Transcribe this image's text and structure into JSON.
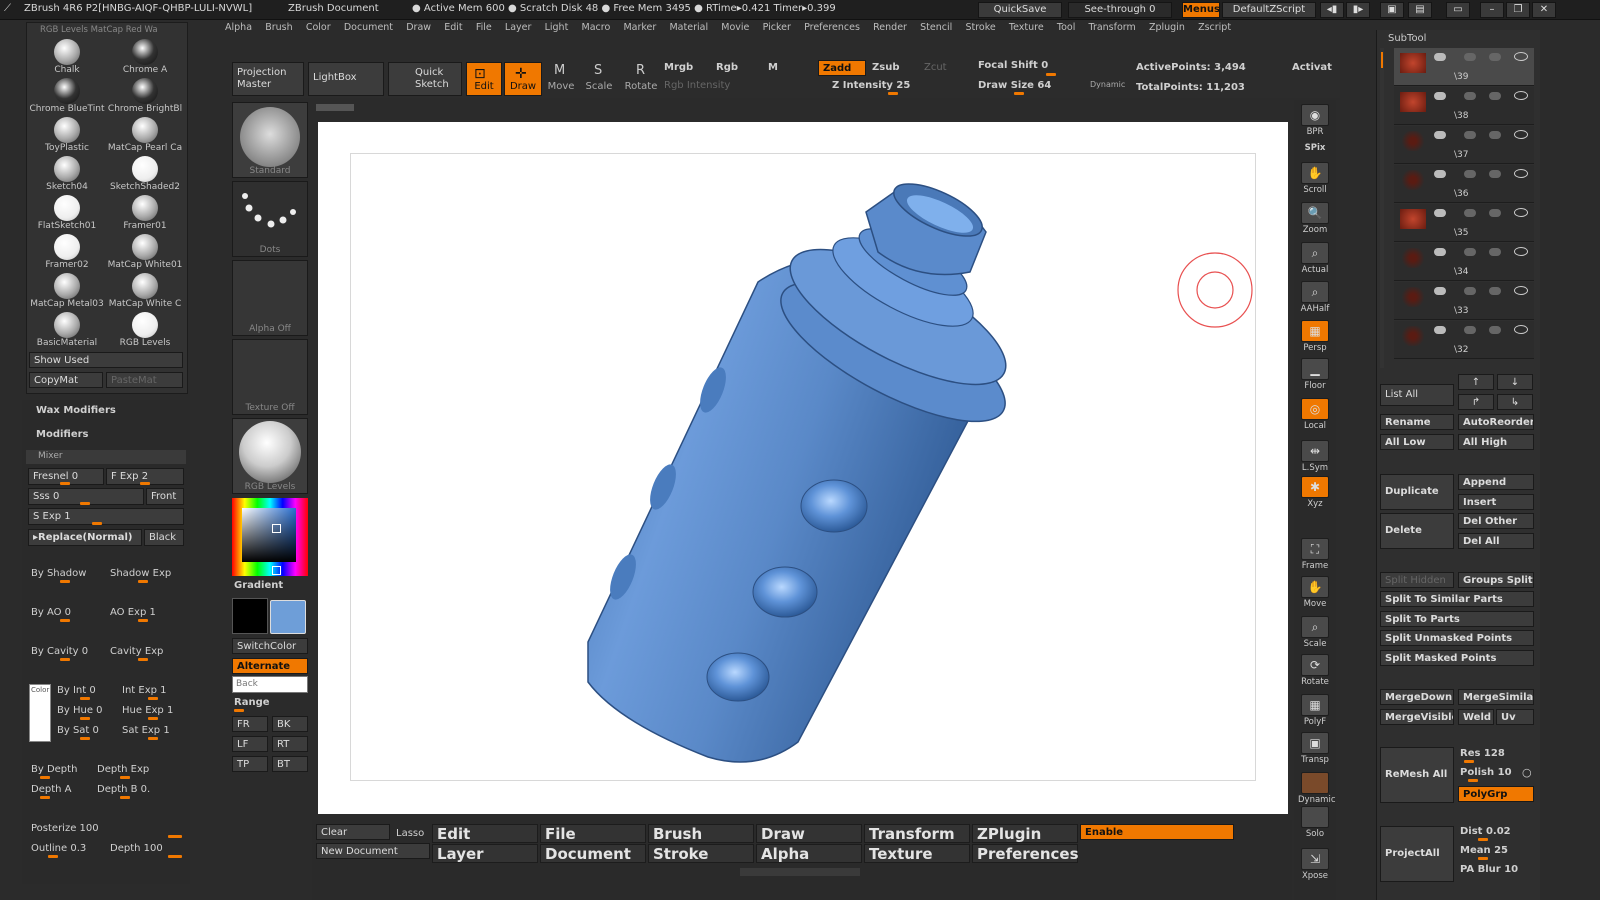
{
  "titlebar": {
    "app": "ZBrush 4R6 P2[HNBG-AIQF-QHBP-LULI-NVWL]",
    "doc": "ZBrush Document",
    "mem": "● Active Mem 600 ● Scratch Disk 48 ● Free Mem 3495 ● RTime▸0.421 Timer▸0.399",
    "quicksave": "QuickSave",
    "seethrough": "See-through 0",
    "menus": "Menus",
    "script": "DefaultZScript"
  },
  "menubar": [
    "Alpha",
    "Brush",
    "Color",
    "Document",
    "Draw",
    "Edit",
    "File",
    "Layer",
    "Light",
    "Macro",
    "Marker",
    "Material",
    "Movie",
    "Picker",
    "Preferences",
    "Render",
    "Stencil",
    "Stroke",
    "Texture",
    "Tool",
    "Transform",
    "Zplugin",
    "Zscript"
  ],
  "materials": {
    "header": "RGB Levels   MatCap Red Wa",
    "items": [
      {
        "label": "Chalk"
      },
      {
        "label": "Chrome A"
      },
      {
        "label": "Chrome BlueTint"
      },
      {
        "label": "Chrome BrightBl"
      },
      {
        "label": "ToyPlastic"
      },
      {
        "label": "MatCap Pearl Ca"
      },
      {
        "label": "Sketch04"
      },
      {
        "label": "SketchShaded2"
      },
      {
        "label": "FlatSketch01"
      },
      {
        "label": "Framer01"
      },
      {
        "label": "Framer02"
      },
      {
        "label": "MatCap White01"
      },
      {
        "label": "MatCap Metal03"
      },
      {
        "label": "MatCap White C"
      },
      {
        "label": "BasicMaterial"
      },
      {
        "label": "RGB Levels"
      }
    ],
    "show_used": "Show Used",
    "copymat": "CopyMat",
    "pastemat": "PasteMat"
  },
  "left_panel": {
    "wax": "Wax Modifiers",
    "modifiers": "Modifiers",
    "mixer": "Mixer",
    "fresnel": "Fresnel 0",
    "fexp": "F Exp 2",
    "sss": "Sss 0",
    "front": "Front",
    "sexp": "S Exp 1",
    "replace": "▸Replace(Normal)",
    "black": "Black",
    "byshadow": "By Shadow",
    "shadowexp": "Shadow Exp",
    "byao": "By AO 0",
    "aoexp": "AO Exp 1",
    "bycavity": "By Cavity 0",
    "cavityexp": "Cavity Exp",
    "color": "Color",
    "byint": "By Int 0",
    "intexp": "Int Exp 1",
    "byhue": "By Hue 0",
    "hueexp": "Hue Exp 1",
    "bysat": "By Sat 0",
    "satexp": "Sat Exp 1",
    "bydepth": "By Depth",
    "depthexp": "Depth Exp",
    "deptha": "Depth A",
    "depthb": "Depth B 0.",
    "posterize": "Posterize 100",
    "outline": "Outline 0.3",
    "depth": "Depth 100"
  },
  "tool_column": {
    "standard": "Standard",
    "dots": "Dots",
    "alpha": "Alpha Off",
    "texture": "Texture Off",
    "rgblevels": "RGB Levels",
    "gradient": "Gradient",
    "switchcolor": "SwitchColor",
    "alternate": "Alternate",
    "back": "Back",
    "range": "Range",
    "fr": "FR",
    "bk": "BK",
    "lf": "LF",
    "rt": "RT",
    "tp": "TP",
    "bt": "BT",
    "main_color": "#6e9ed8"
  },
  "toolbar": {
    "projection": "Projection Master",
    "lightbox": "LightBox",
    "quicksketch": "Quick Sketch",
    "edit": "Edit",
    "draw": "Draw",
    "move": "Move",
    "scale": "Scale",
    "rotate": "Rotate",
    "mrgb": "Mrgb",
    "rgb": "Rgb",
    "m": "M",
    "rgbintensity": "Rgb Intensity",
    "zadd": "Zadd",
    "zsub": "Zsub",
    "zcut": "Zcut",
    "zintensity": "Z Intensity 25",
    "focal": "Focal Shift 0",
    "drawsize": "Draw Size 64",
    "dynamic": "Dynamic",
    "activepoints": "ActivePoints: 3,494",
    "totalpoints": "TotalPoints: 11,203",
    "activate": "Activat"
  },
  "right_shelf": [
    {
      "label": "BPR",
      "glyph": "◉"
    },
    {
      "label": "SPix",
      "glyph": ""
    },
    {
      "label": "Scroll",
      "glyph": "✋"
    },
    {
      "label": "Zoom",
      "glyph": "🔍"
    },
    {
      "label": "Actual",
      "glyph": "⌕"
    },
    {
      "label": "AAHalf",
      "glyph": "⌕"
    },
    {
      "label": "Persp",
      "glyph": "▦"
    },
    {
      "label": "Floor",
      "glyph": "▁"
    },
    {
      "label": "Local",
      "glyph": "◎"
    },
    {
      "label": "L.Sym",
      "glyph": "⇹"
    },
    {
      "label": "Xyz",
      "glyph": "✱"
    },
    {
      "label": "Frame",
      "glyph": "⛶"
    },
    {
      "label": "Move",
      "glyph": "✋"
    },
    {
      "label": "Scale",
      "glyph": "⌕"
    },
    {
      "label": "Rotate",
      "glyph": "⟳"
    },
    {
      "label": "PolyF",
      "glyph": "▦"
    },
    {
      "label": "Transp",
      "glyph": "▣"
    },
    {
      "label": "Dynamic",
      "glyph": ""
    },
    {
      "label": "Solo",
      "glyph": ""
    },
    {
      "label": "Xpose",
      "glyph": "⇲"
    }
  ],
  "subtool": {
    "title": "SubTool",
    "items": [
      "\\39",
      "\\38",
      "\\37",
      "\\36",
      "\\35",
      "\\34",
      "\\33",
      "\\32"
    ],
    "listall": "List All",
    "rename": "Rename",
    "autoreorder": "AutoReorder",
    "alllow": "All Low",
    "allhigh": "All High",
    "duplicate": "Duplicate",
    "append": "Append",
    "insert": "Insert",
    "delete": "Delete",
    "delother": "Del Other",
    "delall": "Del All",
    "splithidden": "Split Hidden",
    "groupssplit": "Groups Split",
    "splitsimilar": "Split To Similar Parts",
    "splitparts": "Split To Parts",
    "splitunmasked": "Split Unmasked Points",
    "splitmasked": "Split Masked Points",
    "mergedown": "MergeDown",
    "mergesimilar": "MergeSimilar",
    "mergevisible": "MergeVisible",
    "weld": "Weld",
    "uv": "Uv",
    "remeshall": "ReMesh All",
    "res": "Res 128",
    "polish": "Polish 10",
    "polygrp": "PolyGrp",
    "projectall": "ProjectAll",
    "dist": "Dist 0.02",
    "mean": "Mean 25",
    "pablur": "PA Blur 10"
  },
  "bottom": {
    "clear": "Clear",
    "newdoc": "New Document",
    "lasso": "Lasso",
    "edit": "Edit",
    "layer": "Layer",
    "file": "File",
    "document": "Document",
    "brush": "Brush",
    "stroke": "Stroke",
    "draw": "Draw",
    "alpha": "Alpha",
    "transform": "Transform",
    "texture": "Texture",
    "zplugin": "ZPlugin",
    "preferences": "Preferences",
    "enable": "Enable"
  },
  "colors": {
    "accent": "#f07800",
    "model": "#5f8fcc",
    "cursor": "#e85050"
  }
}
